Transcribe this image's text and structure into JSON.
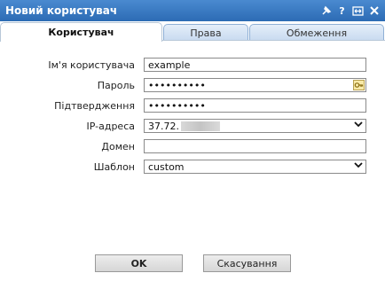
{
  "window": {
    "title": "Новий користувач",
    "icons": [
      "pin-icon",
      "help-icon",
      "resize-icon",
      "close-icon"
    ]
  },
  "tabs": [
    {
      "label": "Користувач",
      "active": true
    },
    {
      "label": "Права",
      "active": false
    },
    {
      "label": "Обмеження",
      "active": false
    }
  ],
  "form": {
    "username": {
      "label": "Ім'я користувача",
      "value": "example"
    },
    "password": {
      "label": "Пароль",
      "value": "••••••••••"
    },
    "confirm": {
      "label": "Підтвердження",
      "value": "••••••••••"
    },
    "ip": {
      "label": "IP-адреса",
      "value": "37.72."
    },
    "domain": {
      "label": "Домен",
      "value": ""
    },
    "template": {
      "label": "Шаблон",
      "value": "custom"
    }
  },
  "buttons": {
    "ok": "OK",
    "cancel": "Скасування"
  },
  "colors": {
    "titlebar": "#2c6bb4",
    "tab_inactive": "#c8daf0",
    "key_icon": "#f7e9a8"
  }
}
